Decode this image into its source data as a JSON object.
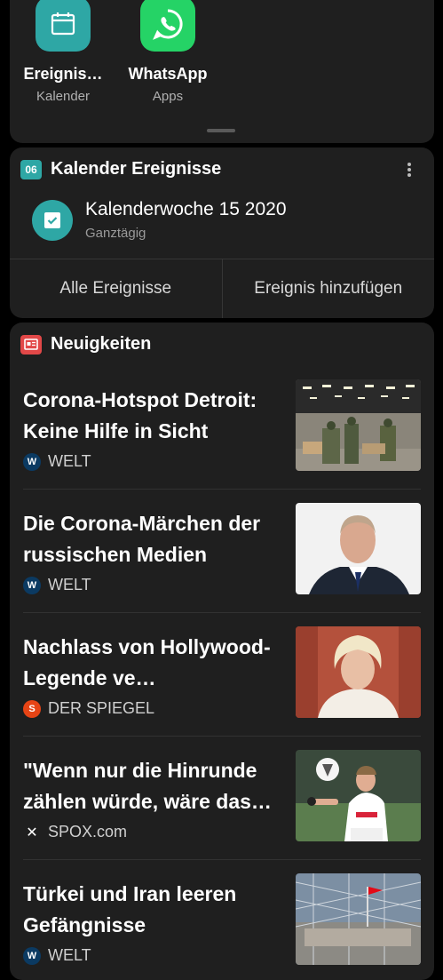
{
  "apps": [
    {
      "name": "Ereignis…",
      "category": "Kalender",
      "icon": "calendar-icon",
      "color": "#2ea7a5"
    },
    {
      "name": "WhatsApp",
      "category": "Apps",
      "icon": "whatsapp-icon",
      "color": "#25d366"
    }
  ],
  "calendar_widget": {
    "badge": "06",
    "title": "Kalender Ereignisse",
    "event_title": "Kalenderwoche 15 2020",
    "event_sub": "Ganztägig",
    "action_all": "Alle Ereignisse",
    "action_add": "Ereignis hinzufügen",
    "accent": "#2ea7a5"
  },
  "news_widget": {
    "title": "Neuigkeiten",
    "accent": "#e24848",
    "articles": [
      {
        "title": "Corona-Hotspot Detroit: Keine Hilfe in Sicht",
        "source": "WELT",
        "logo": "W"
      },
      {
        "title": "Die Corona-Märchen der russischen Medien",
        "source": "WELT",
        "logo": "W"
      },
      {
        "title": "Nachlass von Hollywood-Legende ve…",
        "source": "DER SPIEGEL",
        "logo": "S"
      },
      {
        "title": "\"Wenn nur die Hinrunde zählen würde, wäre das…",
        "source": "SPOX.com",
        "logo": "✕"
      },
      {
        "title": "Türkei und Iran leeren Gefängnisse",
        "source": "WELT",
        "logo": "W"
      }
    ]
  }
}
